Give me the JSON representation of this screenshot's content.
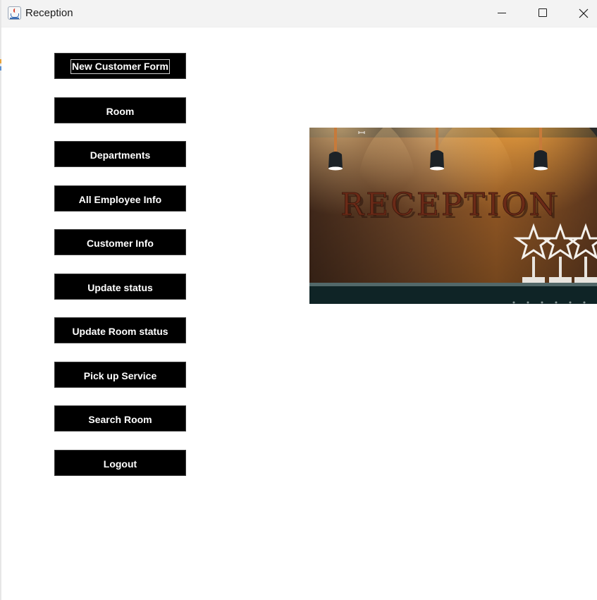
{
  "window": {
    "title": "Reception",
    "icon": "java-cup-icon",
    "controls": [
      "minimize-icon",
      "maximize-icon",
      "close-icon"
    ]
  },
  "menu": {
    "buttons": [
      {
        "label": "New Customer Form",
        "focused": true
      },
      {
        "label": "Room"
      },
      {
        "label": "Departments"
      },
      {
        "label": "All Employee Info"
      },
      {
        "label": "Customer Info"
      },
      {
        "label": "Update status"
      },
      {
        "label": "Update Room status"
      },
      {
        "label": "Pick up Service"
      },
      {
        "label": "Search Room"
      },
      {
        "label": "Logout"
      }
    ]
  },
  "image": {
    "sign_text": "RECEPTION"
  },
  "colors": {
    "button_bg": "#000000",
    "button_text": "#ffffff",
    "titlebar_bg": "#f3f3f3",
    "window_bg": "#ffffff"
  }
}
